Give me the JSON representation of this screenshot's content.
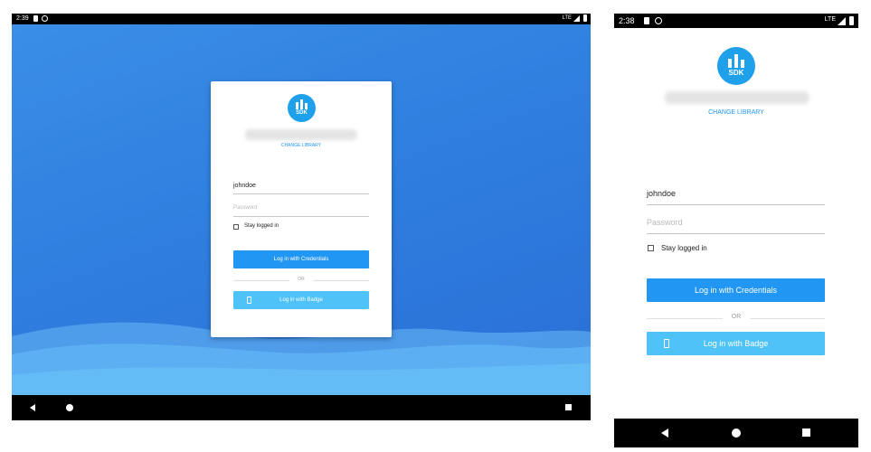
{
  "tablet": {
    "status_bar": {
      "time": "2:39",
      "network": "LTE",
      "icons": [
        "sd-card-icon",
        "sync-icon",
        "signal-icon",
        "battery-icon"
      ]
    },
    "login_card": {
      "logo_text": "SDK",
      "change_library": "CHANGE LIBRARY",
      "username_value": "johndoe",
      "password_placeholder": "Password",
      "stay_logged_in": "Stay logged in",
      "credentials_button": "Log in with Credentials",
      "or_divider": "OR",
      "badge_button": "Log in with Badge"
    },
    "nav_bar": {
      "icons": [
        "back-icon",
        "home-icon",
        "recents-icon"
      ]
    }
  },
  "phone": {
    "status_bar": {
      "time": "2:38",
      "network": "LTE",
      "icons": [
        "sd-card-icon",
        "sync-icon",
        "signal-icon",
        "battery-icon"
      ]
    },
    "login": {
      "logo_text": "SDK",
      "change_library": "CHANGE LIBRARY",
      "username_value": "johndoe",
      "password_placeholder": "Password",
      "stay_logged_in": "Stay logged in",
      "credentials_button": "Log in with Credentials",
      "or_divider": "OR",
      "badge_button": "Log in with Badge"
    },
    "nav_bar": {
      "icons": [
        "back-icon",
        "home-icon",
        "recents-icon"
      ]
    }
  },
  "colors": {
    "primary_button": "#2196f3",
    "badge_button": "#4fc3f7",
    "logo": "#1ea0ea",
    "tablet_background": "#2f7fe0",
    "wave_light": "#64b5f6"
  }
}
